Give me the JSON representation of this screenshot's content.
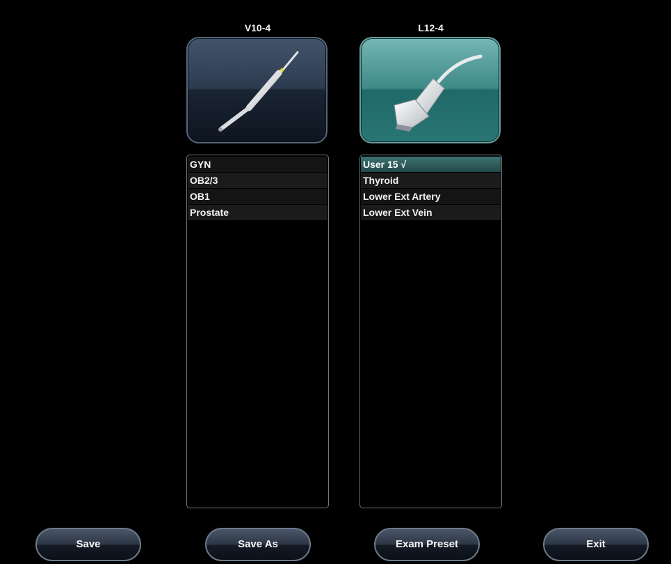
{
  "probes": [
    {
      "name": "V10-4",
      "presets": [
        "GYN",
        "OB2/3",
        "OB1",
        "Prostate"
      ]
    },
    {
      "name": "L12-4",
      "presets": [
        "User 15  √",
        "Thyroid",
        "Lower Ext Artery",
        "Lower Ext Vein"
      ]
    }
  ],
  "buttons": {
    "save": "Save",
    "save_as": "Save As",
    "exam_preset": "Exam Preset",
    "exit": "Exit"
  },
  "icons": {
    "probe1": "endocavity-probe-icon",
    "probe2": "linear-probe-icon"
  },
  "colors": {
    "selected_probe": "#3f8987",
    "unselected_probe": "#2c3b50",
    "selected_preset": "#3d7371"
  }
}
